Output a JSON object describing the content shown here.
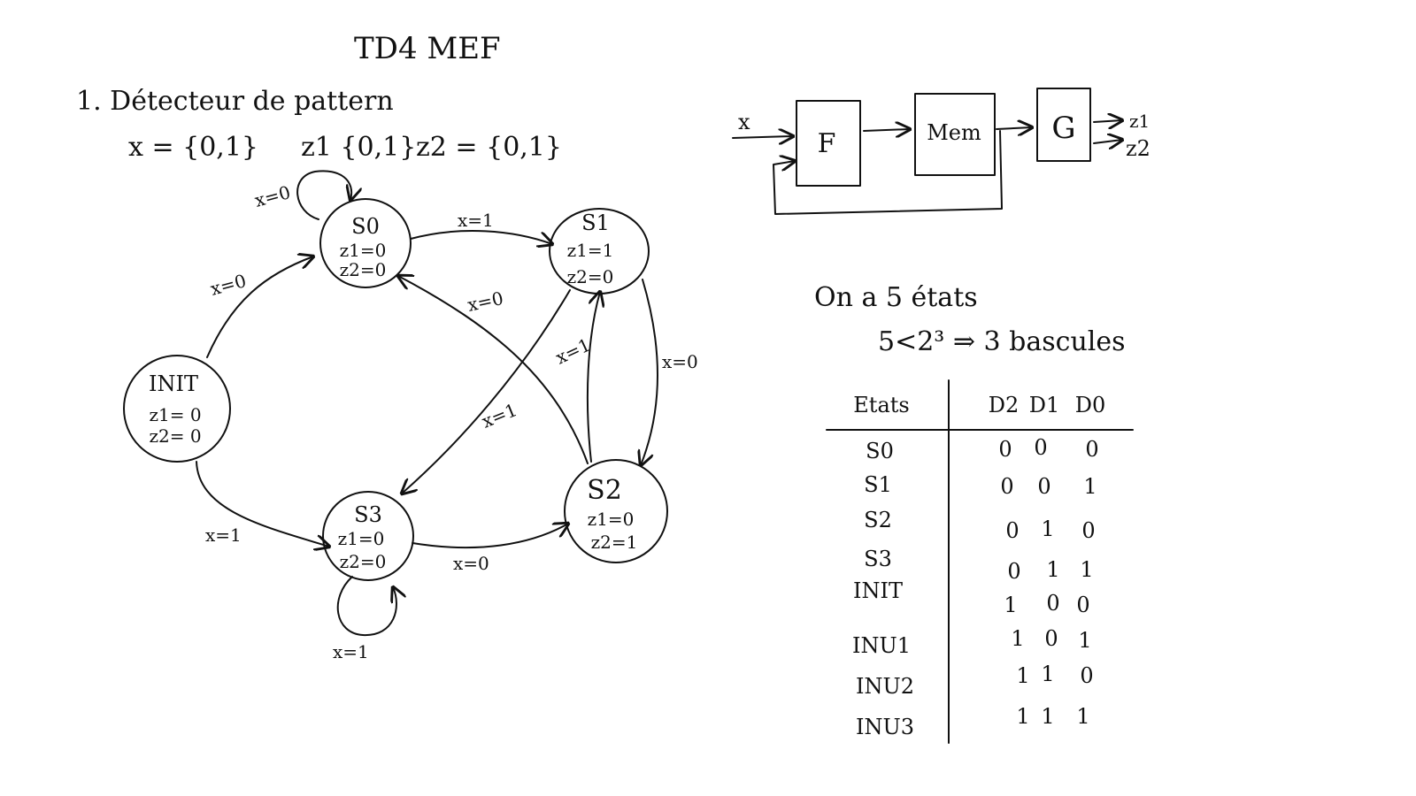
{
  "header": {
    "title": "TD4   MEF",
    "section": "1. Détecteur de pattern",
    "var_x": "x = {0,1}",
    "var_z1": "z1 {0,1}",
    "var_z2": "z2 = {0,1}"
  },
  "states": [
    {
      "id": "S0",
      "label": "S0",
      "z1": "z1=0",
      "z2": "z2=0"
    },
    {
      "id": "S1",
      "label": "S1",
      "z1": "z1=1",
      "z2": "z2=0"
    },
    {
      "id": "S2",
      "label": "S2",
      "z1": "z1=0",
      "z2": "z2=1"
    },
    {
      "id": "S3",
      "label": "S3",
      "z1": "z1=0",
      "z2": "z2=0"
    },
    {
      "id": "INIT",
      "label": "INIT",
      "z1": "z1= 0",
      "z2": "z2= 0"
    }
  ],
  "transitions": [
    {
      "from": "S0",
      "to": "S0",
      "label": "x=0"
    },
    {
      "from": "S0",
      "to": "S1",
      "label": "x=1"
    },
    {
      "from": "S1",
      "to": "S2",
      "label": "x=0"
    },
    {
      "from": "S2",
      "to": "S0",
      "label": "x=0"
    },
    {
      "from": "S2",
      "to": "S1",
      "label": "x=1"
    },
    {
      "from": "S1",
      "to": "S3",
      "label": "x=1"
    },
    {
      "from": "INIT",
      "to": "S0",
      "label": "x=0"
    },
    {
      "from": "INIT",
      "to": "S3",
      "label": "x=1"
    },
    {
      "from": "S3",
      "to": "S3",
      "label": "x=1"
    },
    {
      "from": "S3",
      "to": "S2",
      "label": "x=0"
    }
  ],
  "block_diagram": {
    "input": "x",
    "f": "F",
    "mem": "Mem",
    "g": "G",
    "out1": "z1",
    "out2": "z2"
  },
  "notes": {
    "line1": "On a 5 états",
    "line2": "5<2³  ⇒  3 bascules"
  },
  "table": {
    "headers": [
      "Etats",
      "D2",
      "D1",
      "D0"
    ],
    "rows": [
      [
        "S0",
        "0",
        "0",
        "0"
      ],
      [
        "S1",
        "0",
        "0",
        "1"
      ],
      [
        "S2",
        "0",
        "1",
        "0"
      ],
      [
        "S3",
        "0",
        "1",
        "1"
      ],
      [
        "INIT",
        "1",
        "0",
        "0"
      ],
      [
        "INU1",
        "1",
        "0",
        "1"
      ],
      [
        "INU2",
        "1",
        "1",
        "0"
      ],
      [
        "INU3",
        "1",
        "1",
        "1"
      ]
    ]
  }
}
